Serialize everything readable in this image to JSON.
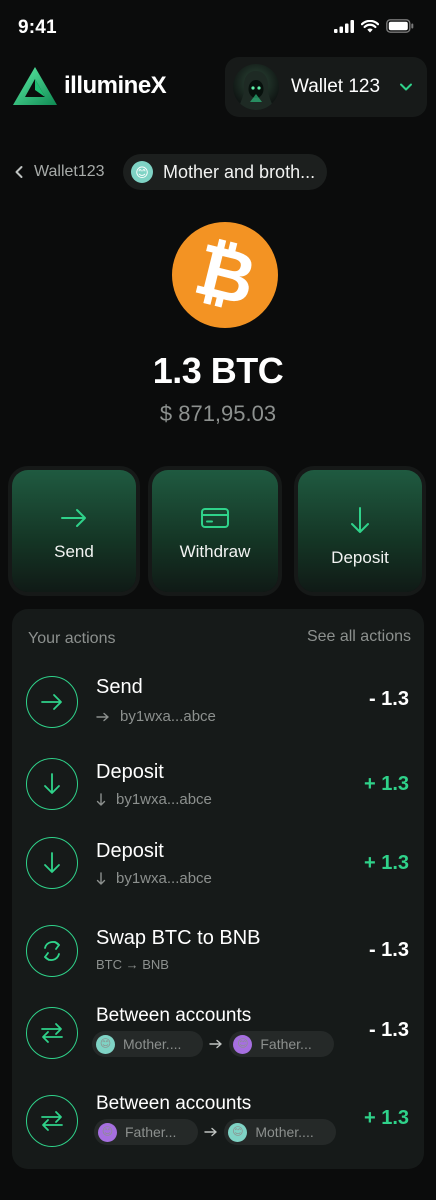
{
  "status_bar": {
    "time": "9:41",
    "icons": [
      "signal-icon",
      "wifi-icon",
      "battery-icon"
    ]
  },
  "header": {
    "app_name": "illumineX",
    "wallet": {
      "name": "Wallet 123"
    }
  },
  "breadcrumb": {
    "back_label": "Wallet123",
    "chip_label": "Mother and broth..."
  },
  "asset": {
    "symbol_glyph": "₿",
    "balance": "1.3 BTC",
    "fiat": "$ 871,95.03"
  },
  "quick_actions": {
    "send": "Send",
    "withdraw": "Withdraw",
    "deposit": "Deposit"
  },
  "actions": {
    "title": "Your actions",
    "see_all": "See all actions",
    "rows": [
      {
        "title": "Send",
        "sub": "by1wxa...abce",
        "amount": "- 1.3"
      },
      {
        "title": "Deposit",
        "sub": "by1wxa...abce",
        "amount": "+ 1.3"
      },
      {
        "title": "Deposit",
        "sub": "by1wxa...abce",
        "amount": "+ 1.3"
      },
      {
        "title": "Swap BTC to BNB",
        "sub": "BTC → BNB",
        "amount": "- 1.3"
      },
      {
        "title": "Between accounts",
        "from": "Mother....",
        "to": "Father...",
        "amount": "- 1.3"
      },
      {
        "title": "Between accounts",
        "from": "Father...",
        "to": "Mother....",
        "amount": "+ 1.3"
      }
    ]
  },
  "colors": {
    "accent": "#2fd28a",
    "background": "#0b0c0c",
    "panel": "#161a19",
    "coin": "#f39323"
  }
}
